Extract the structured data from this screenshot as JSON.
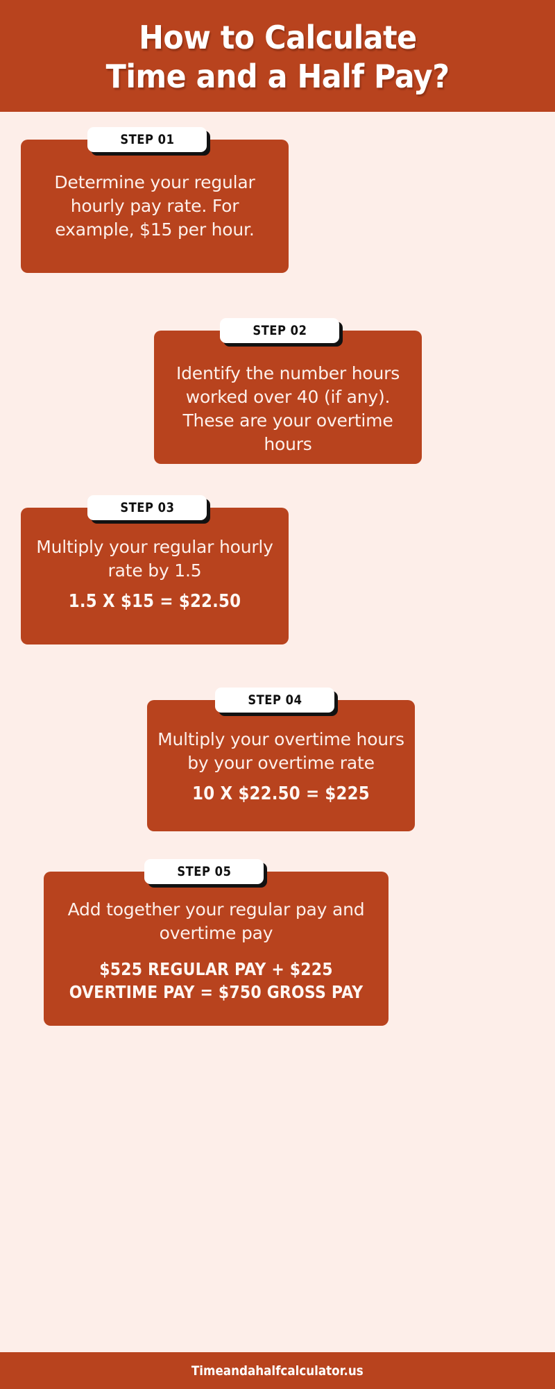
{
  "colors": {
    "brand_orange": "#B8431E",
    "background_cream": "#FDEEE9",
    "badge_white": "#FFFFFF",
    "badge_text": "#101010",
    "card_text": "#FDF0EB"
  },
  "header": {
    "title_line_1": "How to Calculate",
    "title_line_2": "Time and a Half Pay?"
  },
  "steps": [
    {
      "badge": "STEP 01",
      "body": "Determine your regular hourly pay rate. For example, $15 per hour.",
      "formula": ""
    },
    {
      "badge": "STEP 02",
      "body": "Identify the number hours worked over 40 (if any). These are your overtime hours",
      "formula": ""
    },
    {
      "badge": "STEP 03",
      "body": "Multiply your regular hourly rate by 1.5",
      "formula": "1.5 X $15 = $22.50"
    },
    {
      "badge": "STEP 04",
      "body": "Multiply your overtime hours by your overtime rate",
      "formula": "10 X $22.50 = $225"
    },
    {
      "badge": "STEP 05",
      "body": "Add together your regular pay and overtime pay",
      "formula": "$525 REGULAR PAY + $225 OVERTIME PAY = $750 GROSS PAY"
    }
  ],
  "footer": {
    "website": "Timeandahalfcalculator.us"
  }
}
